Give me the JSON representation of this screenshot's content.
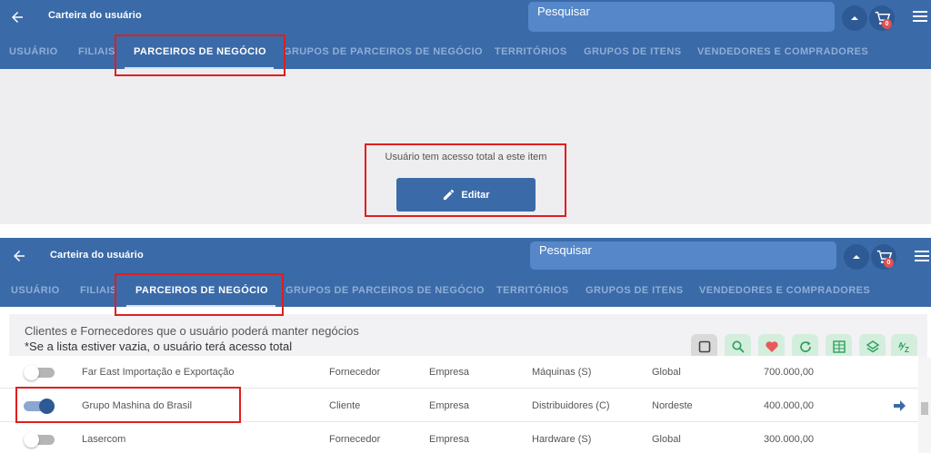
{
  "app": {
    "title": "Carteira do usuário",
    "search_placeholder": "Pesquisar",
    "cart_count": "0"
  },
  "tabs": [
    {
      "label": "USUÁRIO",
      "active": false
    },
    {
      "label": "FILIAIS",
      "active": false
    },
    {
      "label": "PARCEIROS DE NEGÓCIO",
      "active": true
    },
    {
      "label": "GRUPOS DE PARCEIROS DE NEGÓCIO",
      "active": false
    },
    {
      "label": "TERRITÓRIOS",
      "active": false
    },
    {
      "label": "GRUPOS DE ITENS",
      "active": false
    },
    {
      "label": "VENDEDORES E COMPRADORES",
      "active": false
    }
  ],
  "top_panel": {
    "access_text": "Usuário tem acesso total a este item",
    "edit_label": "Editar"
  },
  "bottom_panel": {
    "info_line1": "Clientes e Fornecedores que o usuário poderá manter negócios",
    "info_line2": "*Se a lista estiver vazia, o usuário terá acesso total",
    "toolbar_icons": [
      "checkbox-icon",
      "search-icon",
      "heart-icon",
      "refresh-icon",
      "excel-icon",
      "layers-icon",
      "sort-az-icon"
    ],
    "rows": [
      {
        "enabled": false,
        "name": "Far East Importação e Exportação",
        "type": "Fornecedor",
        "kind": "Empresa",
        "group": "Máquinas (S)",
        "territory": "Global",
        "value": "700.000,00",
        "arrow": false
      },
      {
        "enabled": true,
        "name": "Grupo Mashina do Brasil",
        "type": "Cliente",
        "kind": "Empresa",
        "group": "Distribuidores (C)",
        "territory": "Nordeste",
        "value": "400.000,00",
        "arrow": true
      },
      {
        "enabled": false,
        "name": "Lasercom",
        "type": "Fornecedor",
        "kind": "Empresa",
        "group": "Hardware (S)",
        "territory": "Global",
        "value": "300.000,00",
        "arrow": false
      }
    ]
  },
  "colors": {
    "header_bg": "#3b6aa8",
    "search_bg": "#5587c9",
    "highlight": "#e01e1e",
    "toggle_on": "#2d5a94"
  }
}
